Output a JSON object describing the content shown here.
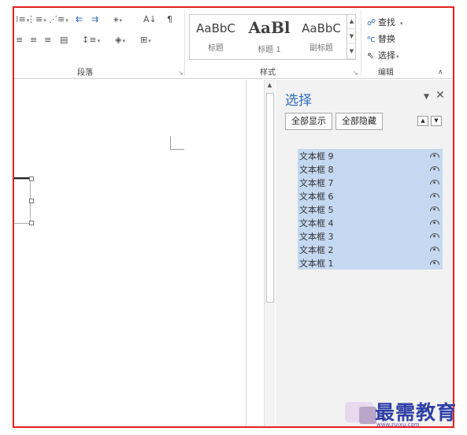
{
  "ribbon": {
    "paragraph_label": "段落",
    "styles_label": "样式",
    "editing_label": "编辑",
    "styles": [
      {
        "sample": "AaBbC",
        "name": "标题"
      },
      {
        "sample": "AaBl",
        "name": "标题 1"
      },
      {
        "sample": "AaBbC",
        "name": "副标题"
      }
    ],
    "find_label": "查找",
    "replace_label": "替换",
    "select_label": "选择"
  },
  "pane": {
    "title": "选择",
    "show_all": "全部显示",
    "hide_all": "全部隐藏",
    "items": [
      {
        "label": "文本框 9"
      },
      {
        "label": "文本框 8"
      },
      {
        "label": "文本框 7"
      },
      {
        "label": "文本框 6"
      },
      {
        "label": "文本框 5"
      },
      {
        "label": "文本框 4"
      },
      {
        "label": "文本框 3"
      },
      {
        "label": "文本框 2"
      },
      {
        "label": "文本框 1"
      }
    ]
  },
  "watermark": {
    "text": "最需教育",
    "url": "www.zuixu.com"
  },
  "colors": {
    "accent": "#2b6cc0",
    "selection": "#c5d8f1",
    "frame_border": "#e3211e"
  }
}
